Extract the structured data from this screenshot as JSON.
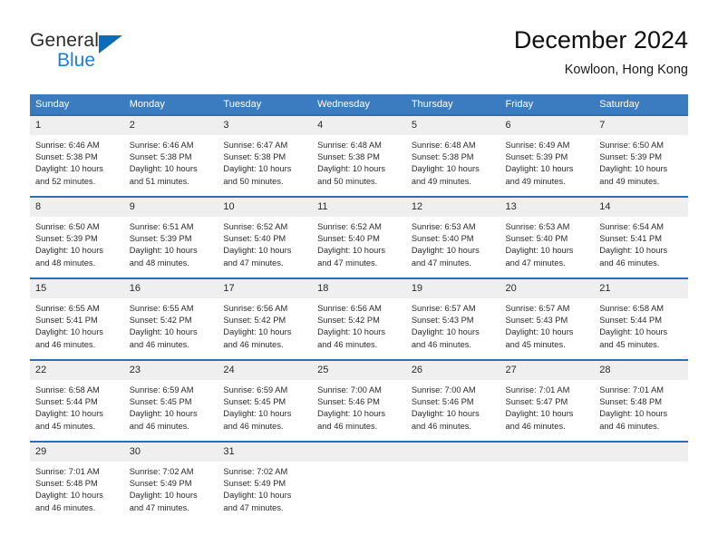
{
  "brand": {
    "name_line1": "General",
    "name_line2": "Blue",
    "triangle_icon": "blue-triangle-icon",
    "accent_color": "#1b7fd4"
  },
  "header": {
    "title": "December 2024",
    "subtitle": "Kowloon, Hong Kong"
  },
  "colors": {
    "header_blue": "#3b7cc0",
    "row_divider_blue": "#2e6eb5",
    "daynum_band": "#efefef",
    "text": "#2b2b2b"
  },
  "weekday_headers": [
    "Sunday",
    "Monday",
    "Tuesday",
    "Wednesday",
    "Thursday",
    "Friday",
    "Saturday"
  ],
  "calendar": {
    "month": "December",
    "year": "2024",
    "location": "Kowloon, Hong Kong",
    "weeks": [
      [
        {
          "day": "1",
          "sunrise": "Sunrise: 6:46 AM",
          "sunset": "Sunset: 5:38 PM",
          "daylight1": "Daylight: 10 hours",
          "daylight2": "and 52 minutes."
        },
        {
          "day": "2",
          "sunrise": "Sunrise: 6:46 AM",
          "sunset": "Sunset: 5:38 PM",
          "daylight1": "Daylight: 10 hours",
          "daylight2": "and 51 minutes."
        },
        {
          "day": "3",
          "sunrise": "Sunrise: 6:47 AM",
          "sunset": "Sunset: 5:38 PM",
          "daylight1": "Daylight: 10 hours",
          "daylight2": "and 50 minutes."
        },
        {
          "day": "4",
          "sunrise": "Sunrise: 6:48 AM",
          "sunset": "Sunset: 5:38 PM",
          "daylight1": "Daylight: 10 hours",
          "daylight2": "and 50 minutes."
        },
        {
          "day": "5",
          "sunrise": "Sunrise: 6:48 AM",
          "sunset": "Sunset: 5:38 PM",
          "daylight1": "Daylight: 10 hours",
          "daylight2": "and 49 minutes."
        },
        {
          "day": "6",
          "sunrise": "Sunrise: 6:49 AM",
          "sunset": "Sunset: 5:39 PM",
          "daylight1": "Daylight: 10 hours",
          "daylight2": "and 49 minutes."
        },
        {
          "day": "7",
          "sunrise": "Sunrise: 6:50 AM",
          "sunset": "Sunset: 5:39 PM",
          "daylight1": "Daylight: 10 hours",
          "daylight2": "and 49 minutes."
        }
      ],
      [
        {
          "day": "8",
          "sunrise": "Sunrise: 6:50 AM",
          "sunset": "Sunset: 5:39 PM",
          "daylight1": "Daylight: 10 hours",
          "daylight2": "and 48 minutes."
        },
        {
          "day": "9",
          "sunrise": "Sunrise: 6:51 AM",
          "sunset": "Sunset: 5:39 PM",
          "daylight1": "Daylight: 10 hours",
          "daylight2": "and 48 minutes."
        },
        {
          "day": "10",
          "sunrise": "Sunrise: 6:52 AM",
          "sunset": "Sunset: 5:40 PM",
          "daylight1": "Daylight: 10 hours",
          "daylight2": "and 47 minutes."
        },
        {
          "day": "11",
          "sunrise": "Sunrise: 6:52 AM",
          "sunset": "Sunset: 5:40 PM",
          "daylight1": "Daylight: 10 hours",
          "daylight2": "and 47 minutes."
        },
        {
          "day": "12",
          "sunrise": "Sunrise: 6:53 AM",
          "sunset": "Sunset: 5:40 PM",
          "daylight1": "Daylight: 10 hours",
          "daylight2": "and 47 minutes."
        },
        {
          "day": "13",
          "sunrise": "Sunrise: 6:53 AM",
          "sunset": "Sunset: 5:40 PM",
          "daylight1": "Daylight: 10 hours",
          "daylight2": "and 47 minutes."
        },
        {
          "day": "14",
          "sunrise": "Sunrise: 6:54 AM",
          "sunset": "Sunset: 5:41 PM",
          "daylight1": "Daylight: 10 hours",
          "daylight2": "and 46 minutes."
        }
      ],
      [
        {
          "day": "15",
          "sunrise": "Sunrise: 6:55 AM",
          "sunset": "Sunset: 5:41 PM",
          "daylight1": "Daylight: 10 hours",
          "daylight2": "and 46 minutes."
        },
        {
          "day": "16",
          "sunrise": "Sunrise: 6:55 AM",
          "sunset": "Sunset: 5:42 PM",
          "daylight1": "Daylight: 10 hours",
          "daylight2": "and 46 minutes."
        },
        {
          "day": "17",
          "sunrise": "Sunrise: 6:56 AM",
          "sunset": "Sunset: 5:42 PM",
          "daylight1": "Daylight: 10 hours",
          "daylight2": "and 46 minutes."
        },
        {
          "day": "18",
          "sunrise": "Sunrise: 6:56 AM",
          "sunset": "Sunset: 5:42 PM",
          "daylight1": "Daylight: 10 hours",
          "daylight2": "and 46 minutes."
        },
        {
          "day": "19",
          "sunrise": "Sunrise: 6:57 AM",
          "sunset": "Sunset: 5:43 PM",
          "daylight1": "Daylight: 10 hours",
          "daylight2": "and 46 minutes."
        },
        {
          "day": "20",
          "sunrise": "Sunrise: 6:57 AM",
          "sunset": "Sunset: 5:43 PM",
          "daylight1": "Daylight: 10 hours",
          "daylight2": "and 45 minutes."
        },
        {
          "day": "21",
          "sunrise": "Sunrise: 6:58 AM",
          "sunset": "Sunset: 5:44 PM",
          "daylight1": "Daylight: 10 hours",
          "daylight2": "and 45 minutes."
        }
      ],
      [
        {
          "day": "22",
          "sunrise": "Sunrise: 6:58 AM",
          "sunset": "Sunset: 5:44 PM",
          "daylight1": "Daylight: 10 hours",
          "daylight2": "and 45 minutes."
        },
        {
          "day": "23",
          "sunrise": "Sunrise: 6:59 AM",
          "sunset": "Sunset: 5:45 PM",
          "daylight1": "Daylight: 10 hours",
          "daylight2": "and 46 minutes."
        },
        {
          "day": "24",
          "sunrise": "Sunrise: 6:59 AM",
          "sunset": "Sunset: 5:45 PM",
          "daylight1": "Daylight: 10 hours",
          "daylight2": "and 46 minutes."
        },
        {
          "day": "25",
          "sunrise": "Sunrise: 7:00 AM",
          "sunset": "Sunset: 5:46 PM",
          "daylight1": "Daylight: 10 hours",
          "daylight2": "and 46 minutes."
        },
        {
          "day": "26",
          "sunrise": "Sunrise: 7:00 AM",
          "sunset": "Sunset: 5:46 PM",
          "daylight1": "Daylight: 10 hours",
          "daylight2": "and 46 minutes."
        },
        {
          "day": "27",
          "sunrise": "Sunrise: 7:01 AM",
          "sunset": "Sunset: 5:47 PM",
          "daylight1": "Daylight: 10 hours",
          "daylight2": "and 46 minutes."
        },
        {
          "day": "28",
          "sunrise": "Sunrise: 7:01 AM",
          "sunset": "Sunset: 5:48 PM",
          "daylight1": "Daylight: 10 hours",
          "daylight2": "and 46 minutes."
        }
      ],
      [
        {
          "day": "29",
          "sunrise": "Sunrise: 7:01 AM",
          "sunset": "Sunset: 5:48 PM",
          "daylight1": "Daylight: 10 hours",
          "daylight2": "and 46 minutes."
        },
        {
          "day": "30",
          "sunrise": "Sunrise: 7:02 AM",
          "sunset": "Sunset: 5:49 PM",
          "daylight1": "Daylight: 10 hours",
          "daylight2": "and 47 minutes."
        },
        {
          "day": "31",
          "sunrise": "Sunrise: 7:02 AM",
          "sunset": "Sunset: 5:49 PM",
          "daylight1": "Daylight: 10 hours",
          "daylight2": "and 47 minutes."
        },
        {
          "day": "",
          "sunrise": "",
          "sunset": "",
          "daylight1": "",
          "daylight2": ""
        },
        {
          "day": "",
          "sunrise": "",
          "sunset": "",
          "daylight1": "",
          "daylight2": ""
        },
        {
          "day": "",
          "sunrise": "",
          "sunset": "",
          "daylight1": "",
          "daylight2": ""
        },
        {
          "day": "",
          "sunrise": "",
          "sunset": "",
          "daylight1": "",
          "daylight2": ""
        }
      ]
    ]
  }
}
